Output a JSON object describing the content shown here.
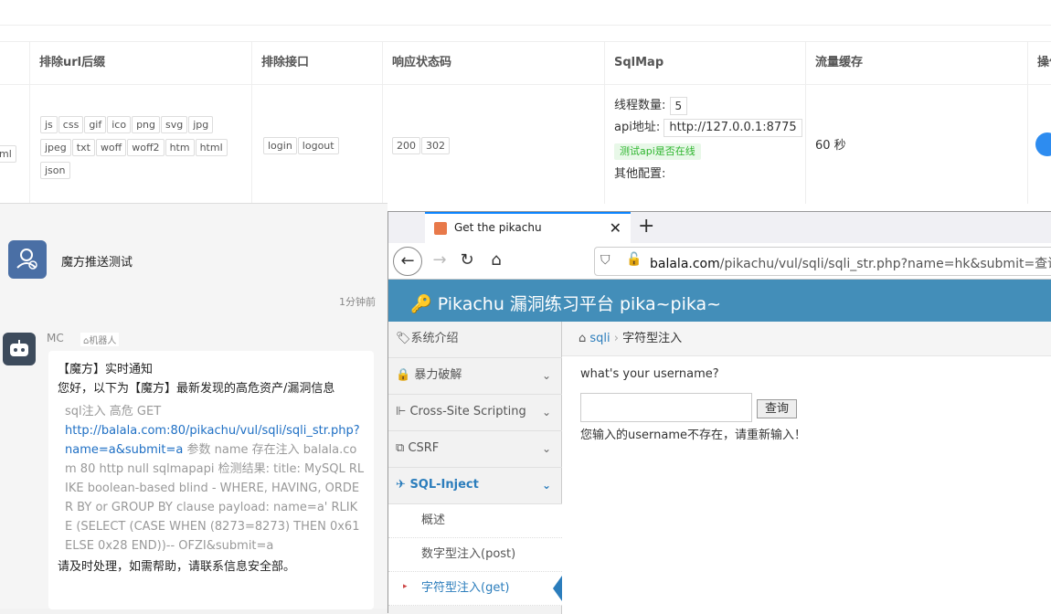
{
  "table": {
    "headers": [
      "排除url后缀",
      "排除接口",
      "响应状态码",
      "SqlMap",
      "流量缓存",
      "操作"
    ],
    "row": {
      "left_tag": "ml",
      "url_suffix_tags": [
        "js",
        "css",
        "gif",
        "ico",
        "png",
        "svg",
        "jpg",
        "jpeg",
        "txt",
        "woff",
        "woff2",
        "htm",
        "html",
        "json"
      ],
      "exclude_api_tags": [
        "login",
        "logout"
      ],
      "status_codes": [
        "200",
        "302"
      ],
      "sqlmap": {
        "threads_label": "线程数量:",
        "threads_value": "5",
        "api_label": "api地址:",
        "api_value": "http://127.0.0.1:8775",
        "test_button": "测试api是否在线",
        "other_label": "其他配置:"
      },
      "cache": "60 秒"
    }
  },
  "chat": {
    "title": "魔方推送测试",
    "time": "1分钟前",
    "sender": "MC",
    "robot_label": "机器人",
    "line1": "【魔方】实时通知",
    "line2": "您好，以下为【魔方】最新发现的高危资产/漏洞信息",
    "quote_prefix": "sql注入 高危 GET",
    "quote_link": "http://balala.com:80/pikachu/vul/sqli/sqli_str.php?name=a&submit=a",
    "quote_rest": " 参数 name 存在注入 balala.com 80 http null sqlmapapi 检测结果: title: MySQL RLIKE boolean-based blind - WHERE, HAVING, ORDER BY or GROUP BY clause payload: name=a' RLIKE (SELECT (CASE WHEN (8273=8273) THEN 0x61 ELSE 0x28 END))-- OFZI&submit=a",
    "footer": "请及时处理，如需帮助，请联系信息安全部。"
  },
  "browser": {
    "tab_title": "Get the pikachu",
    "url_host": "balala.com",
    "url_path": "/pikachu/vul/sqli/sqli_str.php?name=hk&submit=查询",
    "site_title": "Pikachu 漏洞练习平台 pika~pika~",
    "sidebar": [
      {
        "label": "系统介绍",
        "icon": "tag-icon"
      },
      {
        "label": "暴力破解",
        "icon": "lock-icon"
      },
      {
        "label": "Cross-Site Scripting",
        "icon": "tree-icon"
      },
      {
        "label": "CSRF",
        "icon": "share-icon"
      },
      {
        "label": "SQL-Inject",
        "icon": "plane-icon"
      }
    ],
    "subitems": [
      "概述",
      "数字型注入(post)",
      "字符型注入(get)"
    ],
    "breadcrumb_section": "sqli",
    "breadcrumb_page": "字符型注入",
    "question": "what's your username?",
    "query_button": "查询",
    "error_text": "您输入的username不存在，请重新输入！"
  }
}
